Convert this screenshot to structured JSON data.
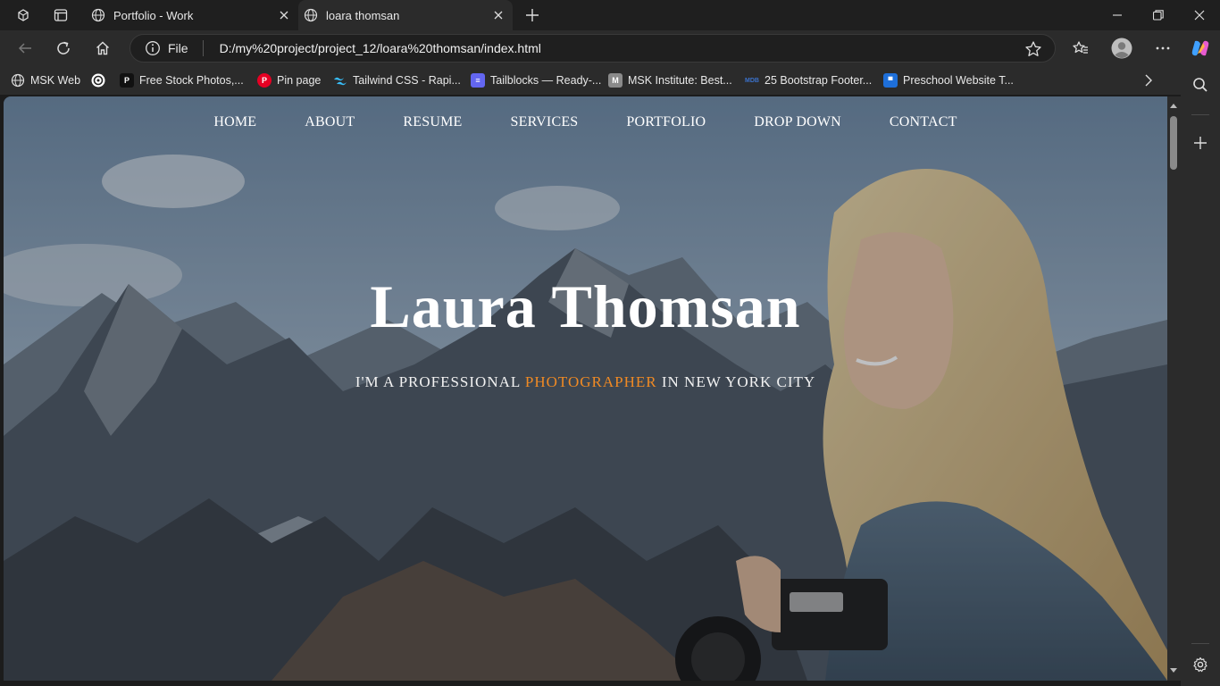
{
  "browser": {
    "tabs": [
      {
        "title": "Portfolio - Work",
        "active": false
      },
      {
        "title": "loara thomsan",
        "active": true
      }
    ],
    "address": {
      "scheme": "File",
      "url": "D:/my%20project/project_12/loara%20thomsan/index.html"
    },
    "bookmarks": [
      {
        "label": "MSK Web",
        "icon": "globe-icon"
      },
      {
        "label": "",
        "icon": "openai-icon"
      },
      {
        "label": "Free Stock Photos,...",
        "icon": "pexels-icon"
      },
      {
        "label": "Pin page",
        "icon": "pinterest-icon"
      },
      {
        "label": "Tailwind CSS - Rapi...",
        "icon": "tailwind-icon"
      },
      {
        "label": "Tailblocks — Ready-...",
        "icon": "tailblocks-icon"
      },
      {
        "label": "MSK Institute: Best...",
        "icon": "msk-institute-icon"
      },
      {
        "label": "25 Bootstrap Footer...",
        "icon": "mdb-icon"
      },
      {
        "label": "Preschool Website T...",
        "icon": "preschool-icon"
      }
    ]
  },
  "site": {
    "nav": [
      "HOME",
      "ABOUT",
      "RESUME",
      "SERVICES",
      "PORTFOLIO",
      "DROP DOWN",
      "CONTACT"
    ],
    "hero": {
      "title": "Laura Thomsan",
      "subtitle_pre": "I'M A PROFESSIONAL",
      "subtitle_accent": "PHOTOGRAPHER",
      "subtitle_post": "IN NEW YORK CITY"
    }
  },
  "colors": {
    "accent": "#f08a24",
    "chrome_dark": "#1f1f1f",
    "chrome": "#2b2b2b"
  }
}
